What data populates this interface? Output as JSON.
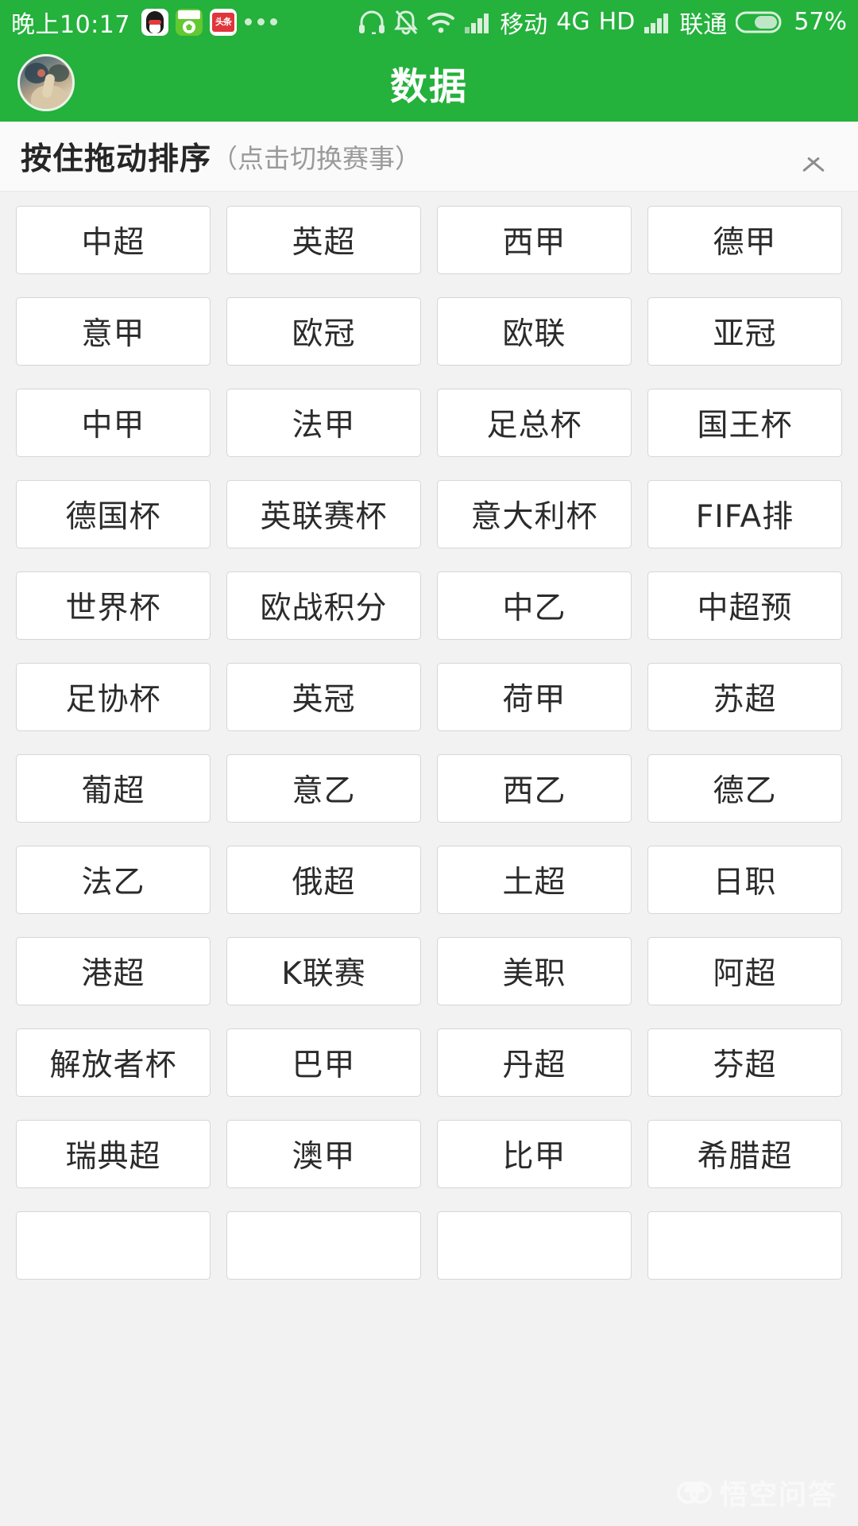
{
  "status_bar": {
    "time": "晚上10:17",
    "app_icons": [
      "qq-icon",
      "football-app-icon",
      "toutiao-icon"
    ],
    "overflow_dots": "...",
    "icons_right": [
      "headset-icon",
      "silent-bell-icon",
      "wifi-icon",
      "signal-icon"
    ],
    "carrier_1": "移动",
    "network_type": "4G",
    "hd_label": "HD",
    "carrier_2": "联通",
    "battery_percent": "57%",
    "battery_level": 57,
    "background_color": "#24b13c",
    "text_color": "#ffffff"
  },
  "title_bar": {
    "title": "数据",
    "avatar": "user-avatar",
    "background_color": "#24b13c"
  },
  "section_header": {
    "main_label": "按住拖动排序",
    "sub_label": "（点击切换赛事）",
    "toggle_icon": "chevron-up-icon"
  },
  "competitions": {
    "rows": [
      [
        "中超",
        "英超",
        "西甲",
        "德甲"
      ],
      [
        "意甲",
        "欧冠",
        "欧联",
        "亚冠"
      ],
      [
        "中甲",
        "法甲",
        "足总杯",
        "国王杯"
      ],
      [
        "德国杯",
        "英联赛杯",
        "意大利杯",
        "FIFA排"
      ],
      [
        "世界杯",
        "欧战积分",
        "中乙",
        "中超预"
      ],
      [
        "足协杯",
        "英冠",
        "荷甲",
        "苏超"
      ],
      [
        "葡超",
        "意乙",
        "西乙",
        "德乙"
      ],
      [
        "法乙",
        "俄超",
        "土超",
        "日职"
      ],
      [
        "港超",
        "K联赛",
        "美职",
        "阿超"
      ],
      [
        "解放者杯",
        "巴甲",
        "丹超",
        "芬超"
      ],
      [
        "瑞典超",
        "澳甲",
        "比甲",
        "希腊超"
      ],
      [
        "",
        "",
        "",
        ""
      ]
    ]
  },
  "watermark": {
    "text": "悟空问答",
    "logo": "wukong-logo"
  },
  "colors": {
    "brand_green": "#24b13c",
    "page_background": "#f2f2f2",
    "chip_background": "#ffffff",
    "chip_border": "#d6d6d6",
    "primary_text": "#2b2b2b",
    "muted_text": "#9a9a9a"
  }
}
